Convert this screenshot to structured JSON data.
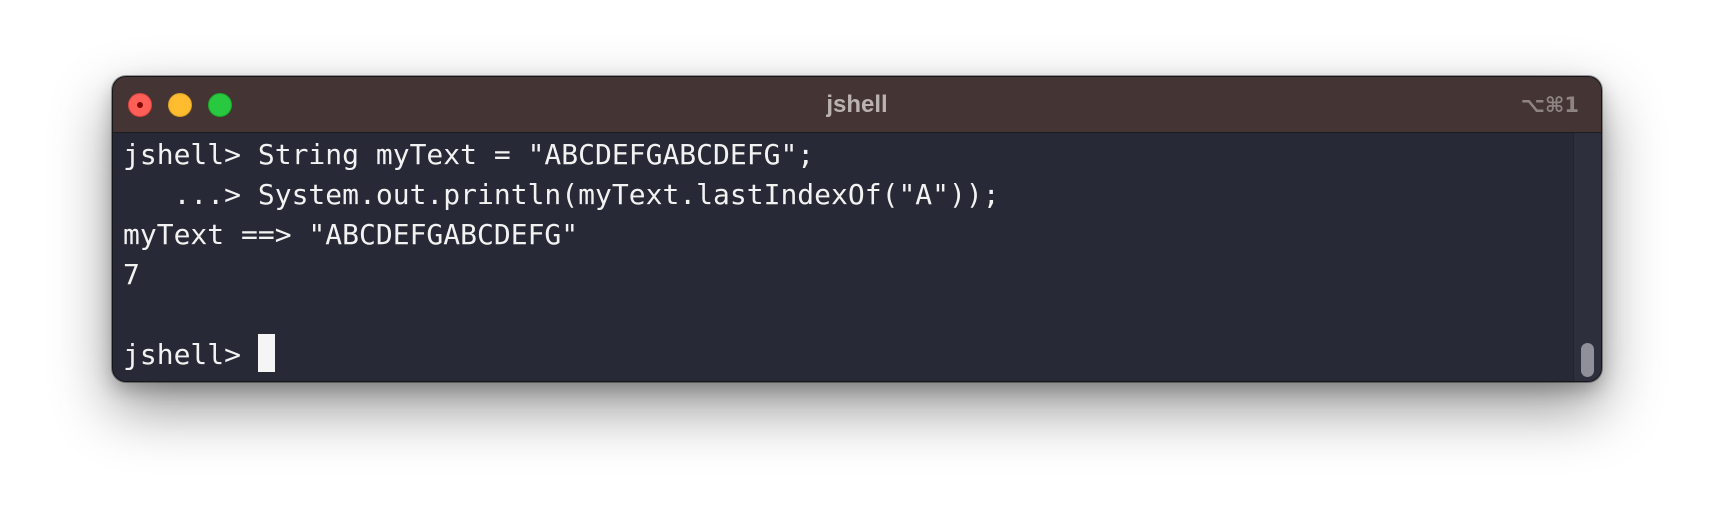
{
  "window": {
    "title": "jshell",
    "shortcut": "⌥⌘1"
  },
  "traffic_lights": {
    "close": "#ff5f57",
    "minimize": "#febc2e",
    "zoom": "#28c840"
  },
  "terminal": {
    "lines": [
      "jshell> String myText = \"ABCDEFGABCDEFG\";",
      "   ...> System.out.println(myText.lastIndexOf(\"A\"));",
      "myText ==> \"ABCDEFGABCDEFG\"",
      "7",
      ""
    ],
    "prompt": "jshell> "
  },
  "colors": {
    "titlebar": "#443534",
    "background": "#272a36",
    "text": "#f2f2f2"
  }
}
